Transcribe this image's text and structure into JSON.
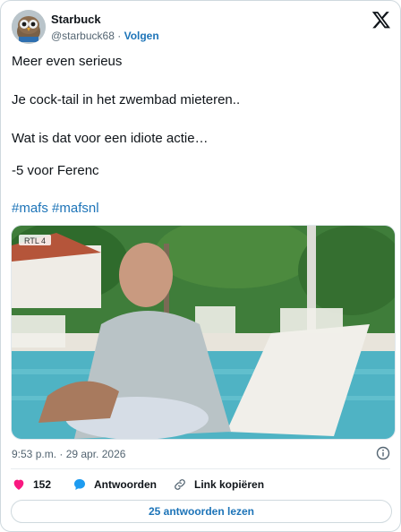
{
  "author": {
    "name": "Starbuck",
    "handle": "@starbuck68",
    "separator": "·",
    "follow_label": "Volgen",
    "avatar_icon": "owl-avatar"
  },
  "brand_icon": "x-logo-icon",
  "tweet": {
    "lines": [
      "Meer even serieus",
      "Je cock-tail in het zwembad mieteren..",
      "Wat is dat voor een idiote actie…",
      "-5 voor Ferenc"
    ],
    "hashtags": "#mafs #mafsnl"
  },
  "media": {
    "watermark": "RTL 4"
  },
  "timestamp": "9:53 p.m. · 29 apr. 2026",
  "actions": {
    "like_count": "152",
    "reply_label": "Antwoorden",
    "copy_label": "Link kopiëren"
  },
  "read_replies_label": "25 antwoorden lezen",
  "colors": {
    "accent": "#1d74b8",
    "like": "#f91880",
    "text": "#0f1419",
    "muted": "#536471"
  }
}
